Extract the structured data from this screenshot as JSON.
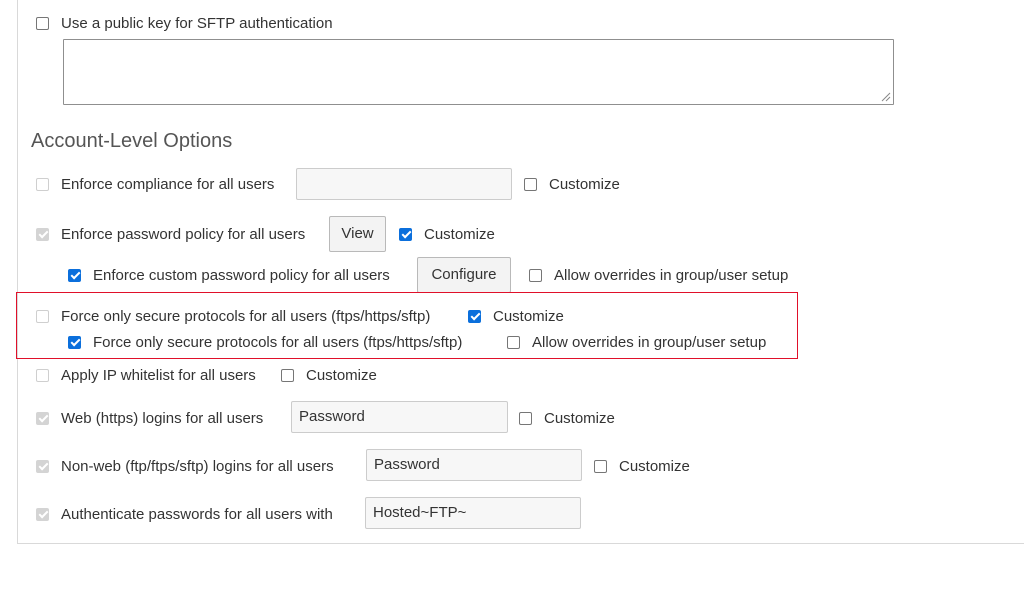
{
  "sftp_public_key": {
    "label": "Use a public key for SFTP authentication",
    "checked": false,
    "value": ""
  },
  "section_title": "Account-Level Options",
  "options": {
    "compliance": {
      "label": "Enforce compliance for all users",
      "checked": false,
      "disabled": true,
      "value": "",
      "customize_label": "Customize",
      "customize_checked": false
    },
    "password_policy": {
      "label": "Enforce password policy for all users",
      "checked": true,
      "disabled": true,
      "button_label": "View",
      "customize_label": "Customize",
      "customize_checked": true
    },
    "custom_password_policy": {
      "label": "Enforce custom password policy for all users",
      "checked": true,
      "button_label": "Configure",
      "override_label": "Allow overrides in group/user setup",
      "override_checked": false
    },
    "secure_protocols": {
      "label": "Force only secure protocols for all users (ftps/https/sftp)",
      "checked": false,
      "disabled": true,
      "customize_label": "Customize",
      "customize_checked": true
    },
    "secure_protocols_custom": {
      "label": "Force only secure protocols for all users (ftps/https/sftp)",
      "checked": true,
      "override_label": "Allow overrides in group/user setup",
      "override_checked": false
    },
    "ip_whitelist": {
      "label": "Apply IP whitelist for all users",
      "checked": false,
      "disabled": true,
      "customize_label": "Customize",
      "customize_checked": false
    },
    "web_logins": {
      "label": "Web (https) logins for all users",
      "checked": true,
      "disabled": true,
      "value": "Password",
      "customize_label": "Customize",
      "customize_checked": false
    },
    "nonweb_logins": {
      "label": "Non-web (ftp/ftps/sftp) logins for all users",
      "checked": true,
      "disabled": true,
      "value": "Password",
      "customize_label": "Customize",
      "customize_checked": false
    },
    "authenticate_passwords": {
      "label": "Authenticate passwords for all users with",
      "checked": true,
      "disabled": true,
      "value": "Hosted~FTP~"
    }
  },
  "colors": {
    "accent": "#0b6fdc",
    "highlight": "#e0102a",
    "title": "#555555"
  }
}
